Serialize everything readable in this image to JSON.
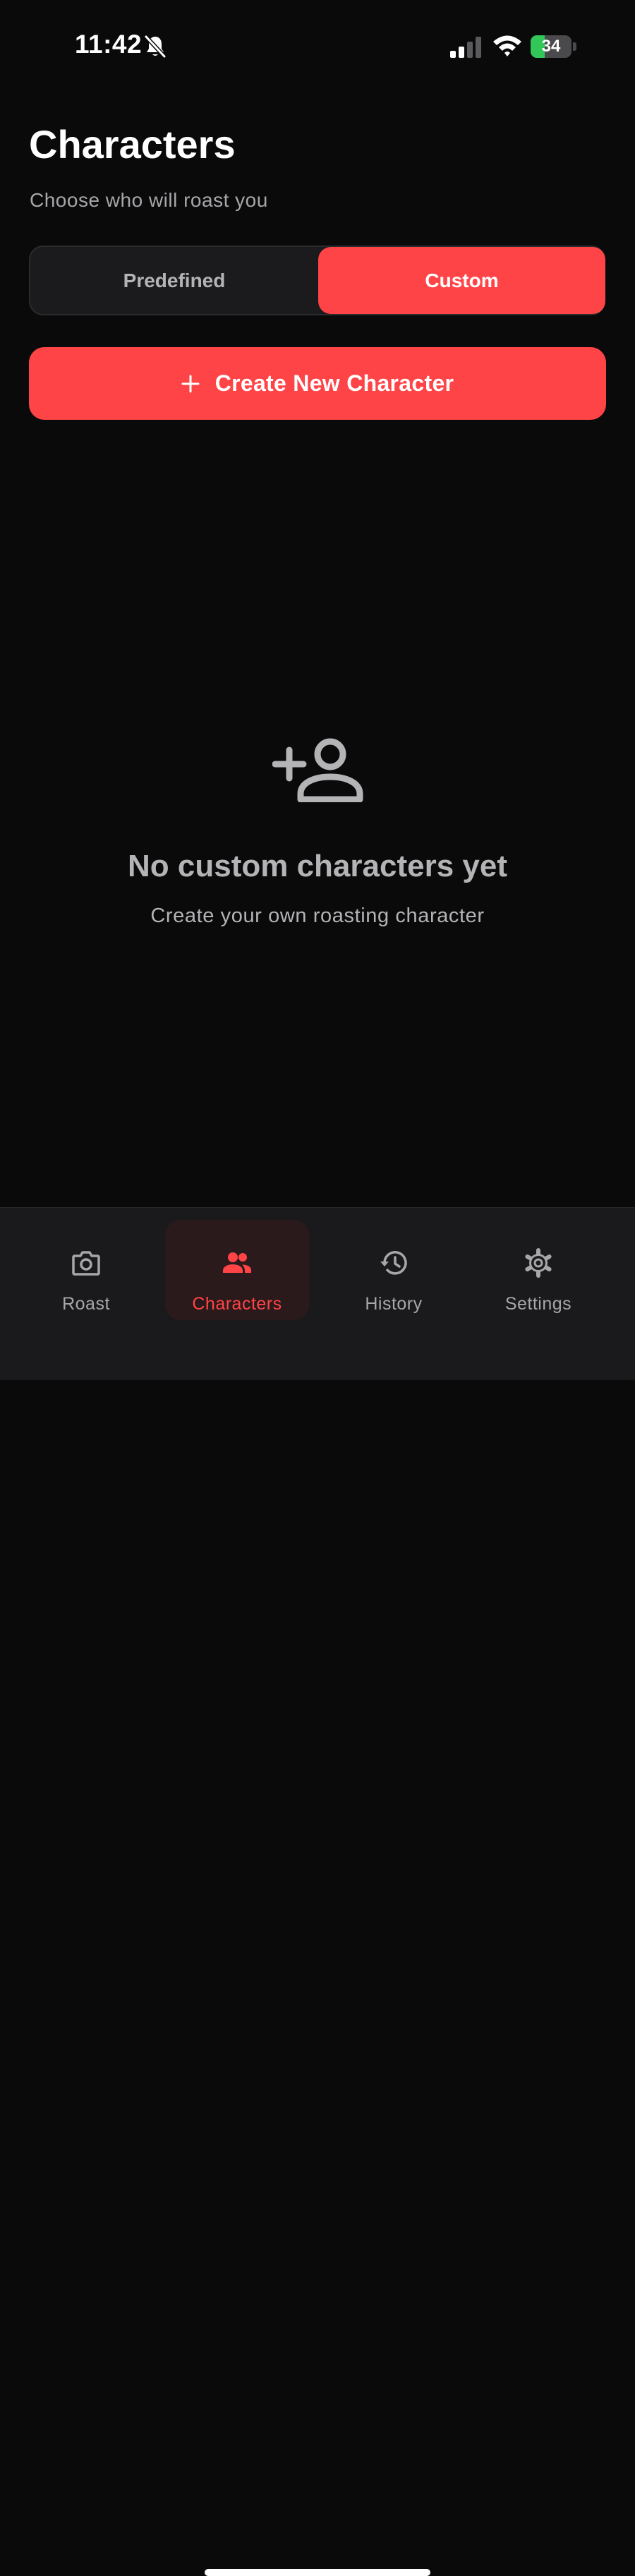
{
  "status_bar": {
    "time": "11:42",
    "battery_level": "34",
    "battery_fraction": 0.34,
    "icons": [
      "bell-slash-icon",
      "cellular-signal-icon",
      "wifi-icon",
      "battery-charging-icon"
    ]
  },
  "header": {
    "title": "Characters",
    "subtitle": "Choose who will roast you"
  },
  "segmented_control": {
    "options": [
      "Predefined",
      "Custom"
    ],
    "selected": "Custom"
  },
  "create_button": {
    "icon": "plus-icon",
    "label": "Create New Character"
  },
  "empty_state": {
    "icon": "person-add-icon",
    "title": "No custom characters yet",
    "subtitle": "Create your own roasting character"
  },
  "tab_bar": {
    "items": [
      {
        "label": "Roast",
        "icon": "camera-icon"
      },
      {
        "label": "Characters",
        "icon": "people-icon"
      },
      {
        "label": "History",
        "icon": "history-icon"
      },
      {
        "label": "Settings",
        "icon": "gear-icon"
      }
    ],
    "selected": "Characters"
  },
  "colors": {
    "background": "#0a0a0b",
    "accent": "#ff4447",
    "tab_bar": "#1a1a1c",
    "muted_text": "#a7a7aa",
    "battery_green": "#32c759"
  }
}
